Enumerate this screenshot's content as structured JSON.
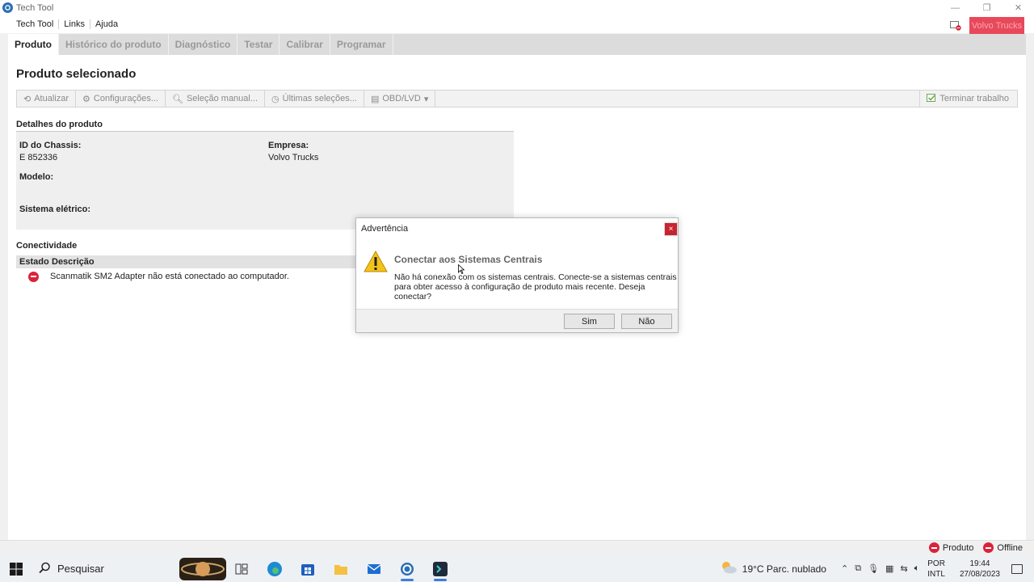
{
  "window": {
    "title": "Tech Tool",
    "controls": [
      "—",
      "❐",
      "✕"
    ]
  },
  "menu": {
    "items": [
      "Tech Tool",
      "Links",
      "Ajuda"
    ],
    "company": "Volvo Trucks"
  },
  "tabs": [
    "Produto",
    "Histórico do produto",
    "Diagnóstico",
    "Testar",
    "Calibrar",
    "Programar"
  ],
  "page": {
    "title": "Produto selecionado"
  },
  "toolbar": {
    "atualizar": "Atualizar",
    "configuracoes": "Configurações...",
    "selecao_manual": "Seleção manual...",
    "ultimas_selecoes": "Últimas seleções...",
    "obd": "OBD/LVD",
    "terminar": "Terminar trabalho"
  },
  "details": {
    "section": "Detalhes do produto",
    "chassis_label": "ID do Chassis:",
    "chassis_value": "E 852336",
    "empresa_label": "Empresa:",
    "empresa_value": "Volvo Trucks",
    "modelo_label": "Modelo:",
    "sistema_label": "Sistema elétrico:"
  },
  "connectivity": {
    "section": "Conectividade",
    "headers": [
      "Estado",
      "Descrição"
    ],
    "rows": [
      {
        "description": "Scanmatik SM2 Adapter não está conectado ao computador."
      }
    ]
  },
  "dialog": {
    "title": "Advertência",
    "close": "×",
    "heading": "Conectar aos Sistemas Centrais",
    "message": "Não há conexão com os sistemas centrais. Conecte-se a sistemas centrais para obter acesso à configuração de produto mais recente. Deseja conectar?",
    "yes": "Sim",
    "no": "Não"
  },
  "status": {
    "produto": "Produto",
    "offline": "Offline"
  },
  "taskbar": {
    "search_placeholder": "Pesquisar",
    "weather": "19°C  Parc. nublado",
    "lang_top": "POR",
    "lang_bottom": "INTL",
    "time": "19:44",
    "date": "27/08/2023"
  },
  "colors": {
    "accent_red": "#e8495a",
    "stop_red": "#d9233a",
    "dialog_close": "#c7242f"
  }
}
